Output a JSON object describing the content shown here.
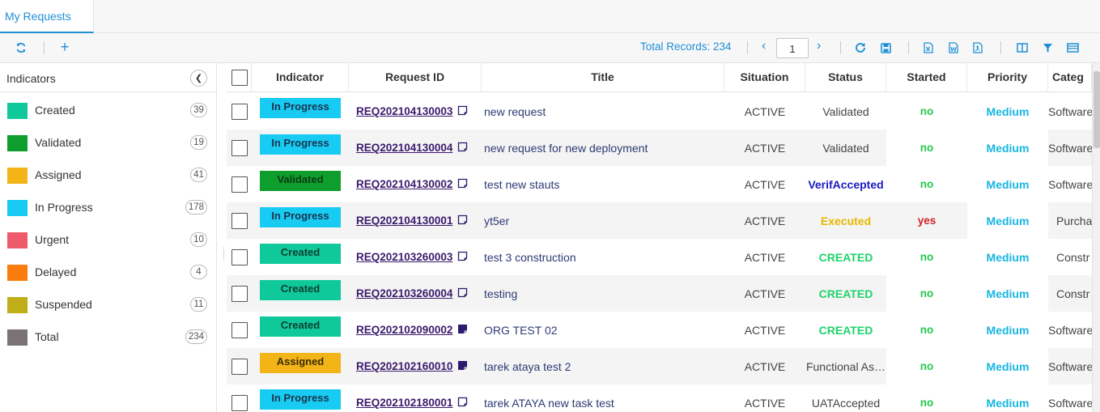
{
  "tabs": [
    {
      "label": "My Requests",
      "active": true
    }
  ],
  "toolbar": {
    "total_records_label": "Total Records: 234",
    "page": "1",
    "icons": [
      "refresh-icon",
      "add-icon",
      "prev-page-icon",
      "next-page-icon",
      "reload-icon",
      "save-icon",
      "excel-export-icon",
      "word-export-icon",
      "pdf-export-icon",
      "columns-icon",
      "filter-icon",
      "layout-icon"
    ]
  },
  "colors": {
    "accent": "#1f8fd6",
    "created": "#0fc99a",
    "validated": "#0e9e2d",
    "assigned": "#f2b416",
    "in_progress": "#17cbf2",
    "urgent": "#ef5a6a",
    "delayed": "#fb7c0c",
    "suspended": "#bfae18",
    "total": "#7b7373"
  },
  "indicators": {
    "title": "Indicators",
    "items": [
      {
        "label": "Created",
        "count": "39",
        "color": "#0fc99a"
      },
      {
        "label": "Validated",
        "count": "19",
        "color": "#0e9e2d"
      },
      {
        "label": "Assigned",
        "count": "41",
        "color": "#f2b416"
      },
      {
        "label": "In Progress",
        "count": "178",
        "color": "#17cbf2"
      },
      {
        "label": "Urgent",
        "count": "10",
        "color": "#ef5a6a"
      },
      {
        "label": "Delayed",
        "count": "4",
        "color": "#fb7c0c"
      },
      {
        "label": "Suspended",
        "count": "11",
        "color": "#bfae18"
      },
      {
        "label": "Total",
        "count": "234",
        "color": "#7b7373"
      }
    ]
  },
  "grid": {
    "columns": [
      "Indicator",
      "Request ID",
      "Title",
      "Situation",
      "Status",
      "Started",
      "Priority",
      "Categ"
    ],
    "rows": [
      {
        "indicator": "In Progress",
        "indicator_color": "#17cbf2",
        "indicator_text_color": "#1a3550",
        "request_id": "REQ202104130003",
        "doc_filled": false,
        "title": "new request",
        "situation": "ACTIVE",
        "status": "Validated",
        "status_color": "#444444",
        "status_bold": false,
        "started": "no",
        "started_color": "#26c94d",
        "priority": "Medium",
        "category": "Software"
      },
      {
        "indicator": "In Progress",
        "indicator_color": "#17cbf2",
        "indicator_text_color": "#1a3550",
        "request_id": "REQ202104130004",
        "doc_filled": false,
        "title": "new request for new deployment",
        "situation": "ACTIVE",
        "status": "Validated",
        "status_color": "#444444",
        "status_bold": false,
        "started": "no",
        "started_color": "#26c94d",
        "priority": "Medium",
        "category": "Software"
      },
      {
        "indicator": "Validated",
        "indicator_color": "#0e9e2d",
        "indicator_text_color": "#0b3a14",
        "request_id": "REQ202104130002",
        "doc_filled": false,
        "title": "test new stauts",
        "situation": "ACTIVE",
        "status": "VerifAccepted",
        "status_color": "#1b1bc4",
        "status_bold": true,
        "started": "no",
        "started_color": "#26c94d",
        "priority": "Medium",
        "category": "Software"
      },
      {
        "indicator": "In Progress",
        "indicator_color": "#17cbf2",
        "indicator_text_color": "#1a3550",
        "request_id": "REQ202104130001",
        "doc_filled": false,
        "title": "yt5er",
        "situation": "ACTIVE",
        "status": "Executed",
        "status_color": "#e6b800",
        "status_bold": true,
        "started": "yes",
        "started_color": "#d0202a",
        "priority": "Medium",
        "category": "Purcha"
      },
      {
        "indicator": "Created",
        "indicator_color": "#0fc99a",
        "indicator_text_color": "#0d3d30",
        "request_id": "REQ202103260003",
        "doc_filled": false,
        "title": "test 3 construction",
        "situation": "ACTIVE",
        "status": "CREATED",
        "status_color": "#1dd36a",
        "status_bold": true,
        "started": "no",
        "started_color": "#26c94d",
        "priority": "Medium",
        "category": "Constr"
      },
      {
        "indicator": "Created",
        "indicator_color": "#0fc99a",
        "indicator_text_color": "#0d3d30",
        "request_id": "REQ202103260004",
        "doc_filled": false,
        "title": "testing",
        "situation": "ACTIVE",
        "status": "CREATED",
        "status_color": "#1dd36a",
        "status_bold": true,
        "started": "no",
        "started_color": "#26c94d",
        "priority": "Medium",
        "category": "Constr"
      },
      {
        "indicator": "Created",
        "indicator_color": "#0fc99a",
        "indicator_text_color": "#0d3d30",
        "request_id": "REQ202102090002",
        "doc_filled": true,
        "title": "ORG TEST 02",
        "situation": "ACTIVE",
        "status": "CREATED",
        "status_color": "#1dd36a",
        "status_bold": true,
        "started": "no",
        "started_color": "#26c94d",
        "priority": "Medium",
        "category": "Software"
      },
      {
        "indicator": "Assigned",
        "indicator_color": "#f2b416",
        "indicator_text_color": "#3b2c05",
        "request_id": "REQ202102160010",
        "doc_filled": true,
        "title": "tarek ataya test 2",
        "situation": "ACTIVE",
        "status": "Functional As…",
        "status_color": "#444444",
        "status_bold": false,
        "started": "no",
        "started_color": "#26c94d",
        "priority": "Medium",
        "category": "Software"
      },
      {
        "indicator": "In Progress",
        "indicator_color": "#17cbf2",
        "indicator_text_color": "#1a3550",
        "request_id": "REQ202102180001",
        "doc_filled": false,
        "title": "tarek ATAYA new task test",
        "situation": "ACTIVE",
        "status": "UATAccepted",
        "status_color": "#444444",
        "status_bold": false,
        "started": "no",
        "started_color": "#26c94d",
        "priority": "Medium",
        "category": "Software"
      }
    ],
    "priority_color": "#17b6e0"
  }
}
